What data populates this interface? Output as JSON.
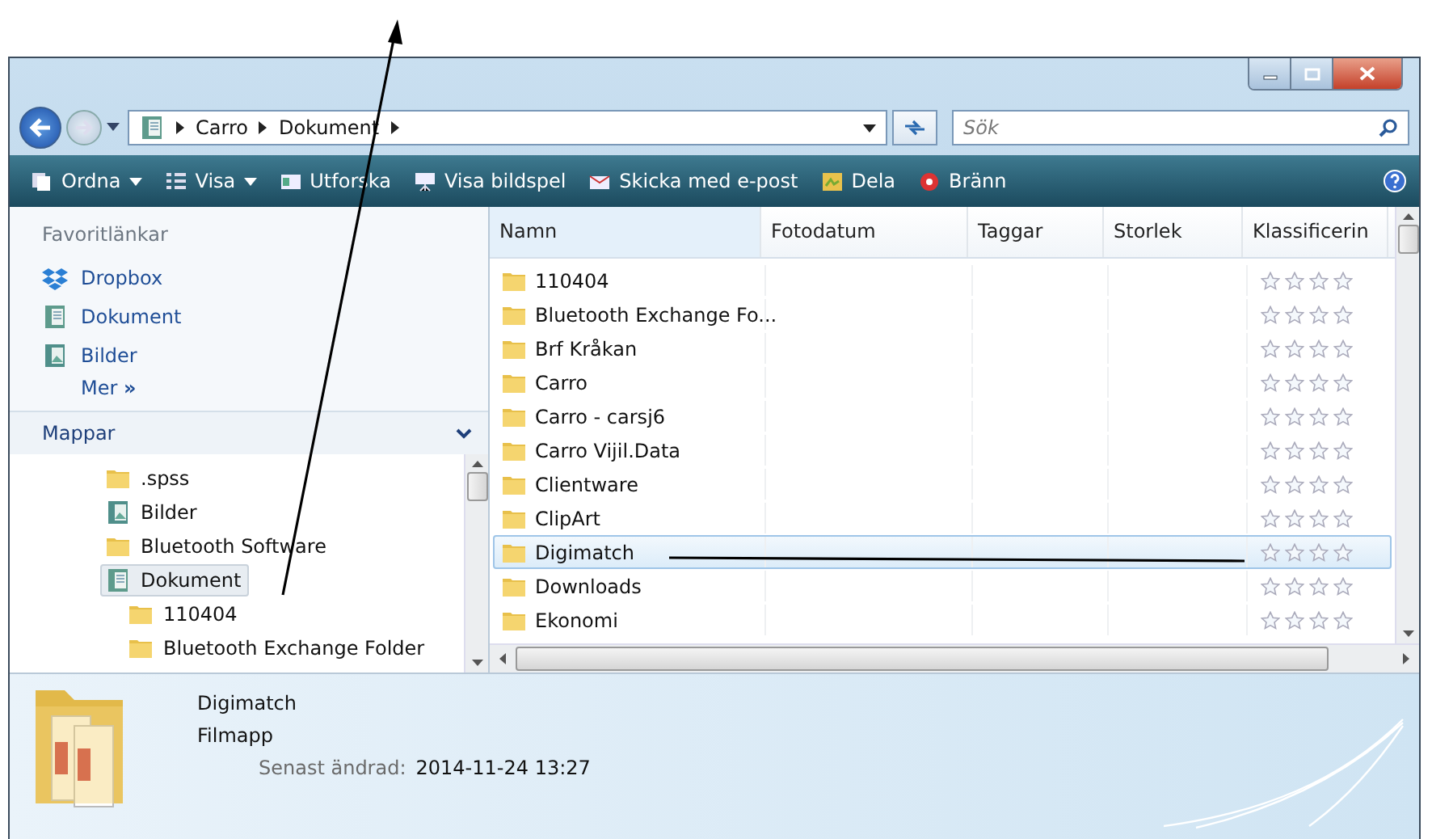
{
  "address": {
    "breadcrumb": [
      "Carro",
      "Dokument"
    ]
  },
  "search": {
    "placeholder": "Sök"
  },
  "toolbar": [
    {
      "label": "Ordna",
      "kind": "menu"
    },
    {
      "label": "Visa",
      "kind": "menu"
    },
    {
      "label": "Utforska",
      "kind": "action"
    },
    {
      "label": "Visa bildspel",
      "kind": "action"
    },
    {
      "label": "Skicka med e-post",
      "kind": "action"
    },
    {
      "label": "Dela",
      "kind": "action"
    },
    {
      "label": "Bränn",
      "kind": "action"
    }
  ],
  "favorites": {
    "title": "Favoritlänkar",
    "items": [
      {
        "label": "Dropbox",
        "kind": "dropbox"
      },
      {
        "label": "Dokument",
        "kind": "library"
      },
      {
        "label": "Bilder",
        "kind": "pictures"
      }
    ],
    "more": "Mer",
    "more_glyph": "»"
  },
  "folders": {
    "title": "Mappar",
    "tree": [
      {
        "label": ".spss",
        "kind": "folder",
        "selected": false
      },
      {
        "label": "Bilder",
        "kind": "pictures",
        "selected": false
      },
      {
        "label": "Bluetooth Software",
        "kind": "folder",
        "selected": false
      },
      {
        "label": "Dokument",
        "kind": "library",
        "selected": true,
        "children": [
          {
            "label": "110404",
            "kind": "folder",
            "selected": false
          },
          {
            "label": "Bluetooth Exchange Folder",
            "kind": "folder",
            "selected": false
          }
        ]
      }
    ]
  },
  "file_list": {
    "columns": [
      "Namn",
      "Fotodatum",
      "Taggar",
      "Storlek",
      "Klassificerin"
    ],
    "rows": [
      {
        "name": "110404",
        "selected": false,
        "stars": 0
      },
      {
        "name": "Bluetooth Exchange Fo...",
        "selected": false,
        "stars": 0
      },
      {
        "name": "Brf Kråkan",
        "selected": false,
        "stars": 0
      },
      {
        "name": "Carro",
        "selected": false,
        "stars": 0
      },
      {
        "name": "Carro - carsj6",
        "selected": false,
        "stars": 0
      },
      {
        "name": "Carro Vijil.Data",
        "selected": false,
        "stars": 0
      },
      {
        "name": "Clientware",
        "selected": false,
        "stars": 0
      },
      {
        "name": "ClipArt",
        "selected": false,
        "stars": 0
      },
      {
        "name": "Digimatch",
        "selected": true,
        "stars": 0
      },
      {
        "name": "Downloads",
        "selected": false,
        "stars": 0
      },
      {
        "name": "Ekonomi",
        "selected": false,
        "stars": 0
      }
    ]
  },
  "details": {
    "name": "Digimatch",
    "type": "Filmapp",
    "fields": [
      {
        "label": "Senast ändrad:",
        "value": "2014-11-24 13:27"
      }
    ]
  }
}
